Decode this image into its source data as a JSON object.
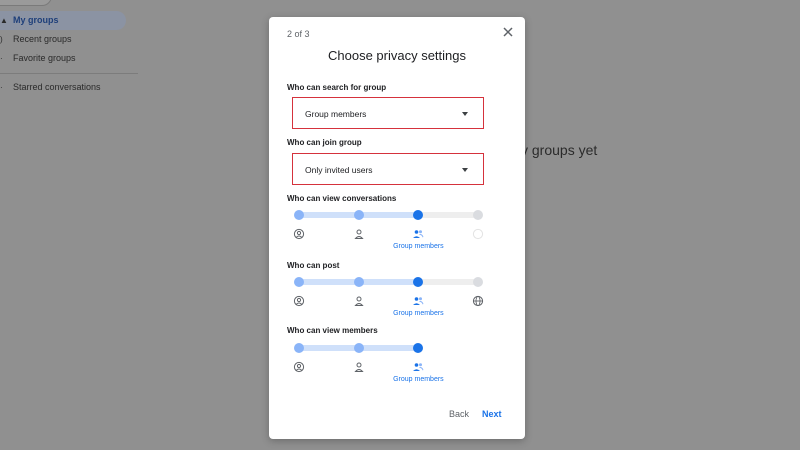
{
  "background": {
    "nav_items": [
      {
        "label": "My groups",
        "icon": "my-groups-icon",
        "active": true
      },
      {
        "label": "Recent groups",
        "icon": "recent-groups-icon",
        "active": false
      },
      {
        "label": "Favorite groups",
        "icon": "favorite-groups-icon",
        "active": false
      },
      {
        "label": "Starred conversations",
        "icon": "starred-icon",
        "active": false
      }
    ],
    "empty_text": "y groups yet"
  },
  "dialog": {
    "step": "2 of 3",
    "title": "Choose privacy settings",
    "search": {
      "label": "Who can search for group",
      "value": "Group members"
    },
    "join": {
      "label": "Who can join group",
      "value": "Only invited users"
    },
    "view_conversations": {
      "label": "Who can view conversations",
      "selected_index": 2,
      "options": [
        {
          "icon": "globe-account-icon",
          "text": ""
        },
        {
          "icon": "person-icon",
          "text": ""
        },
        {
          "icon": "group-members-icon",
          "text": "Group members"
        },
        {
          "icon": "disabled-option-icon",
          "text": ""
        }
      ]
    },
    "post": {
      "label": "Who can post",
      "selected_index": 2,
      "options": [
        {
          "icon": "globe-account-icon",
          "text": ""
        },
        {
          "icon": "person-icon",
          "text": ""
        },
        {
          "icon": "group-members-icon",
          "text": "Group members"
        },
        {
          "icon": "globe-icon",
          "text": ""
        }
      ]
    },
    "view_members": {
      "label": "Who can view members",
      "selected_index": 2,
      "options": [
        {
          "icon": "globe-account-icon",
          "text": ""
        },
        {
          "icon": "person-icon",
          "text": ""
        },
        {
          "icon": "group-members-icon",
          "text": "Group members"
        }
      ]
    },
    "back_label": "Back",
    "next_label": "Next"
  },
  "colors": {
    "accent": "#1a73e8",
    "highlight_border": "#d5323c",
    "overlay": "#909090"
  }
}
